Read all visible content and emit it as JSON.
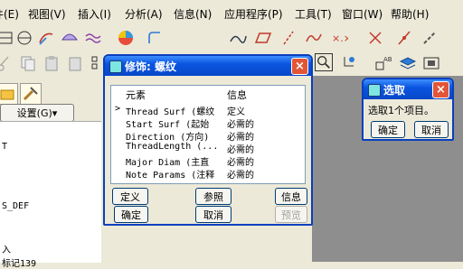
{
  "menu": [
    "件(E)",
    "视图(V)",
    "插入(I)",
    "分析(A)",
    "信息(N)",
    "应用程序(P)",
    "工具(T)",
    "窗口(W)",
    "帮助(H)"
  ],
  "left_panel": {
    "settings_label": "设置(G)▾",
    "tree_items": [
      "T",
      "S_DEF",
      "入",
      "标记139"
    ]
  },
  "thread_dialog": {
    "title": "修饰: 螺纹",
    "columns": [
      "元素",
      "信息"
    ],
    "rows": [
      {
        "marker": ">",
        "element": "Thread Surf (螺纹",
        "info": "定义"
      },
      {
        "marker": "",
        "element": "Start Surf (起始",
        "info": "必需的"
      },
      {
        "marker": "",
        "element": "Direction (方向)",
        "info": "必需的"
      },
      {
        "marker": "",
        "element": "ThreadLength (...",
        "info": "必需的"
      },
      {
        "marker": "",
        "element": "Major Diam (主直",
        "info": "必需的"
      },
      {
        "marker": "",
        "element": "Note Params (注释",
        "info": "必需的"
      }
    ],
    "buttons": {
      "define": "定义",
      "reference": "参照",
      "info": "信息",
      "ok": "确定",
      "cancel": "取消",
      "preview": "预览"
    }
  },
  "select_dialog": {
    "title": "选取",
    "message": "选取1个项目。",
    "ok": "确定",
    "cancel": "取消"
  }
}
